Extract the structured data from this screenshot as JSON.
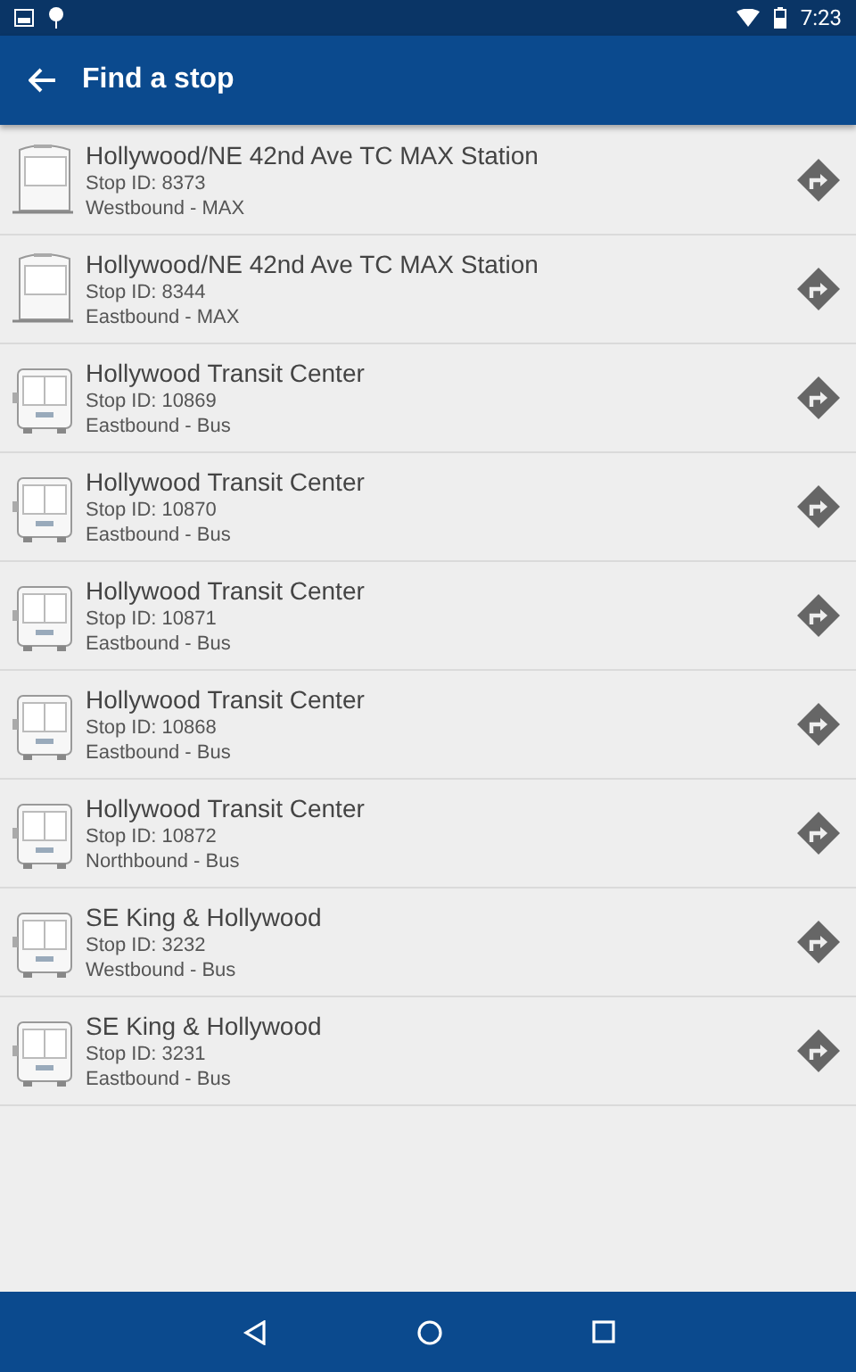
{
  "status_bar": {
    "time": "7:23"
  },
  "app_bar": {
    "title": "Find a stop"
  },
  "stops": [
    {
      "kind": "rail",
      "name": "Hollywood/NE 42nd Ave TC MAX Station",
      "stop_id": "Stop ID: 8373",
      "direction": "Westbound - MAX"
    },
    {
      "kind": "rail",
      "name": "Hollywood/NE 42nd Ave TC MAX Station",
      "stop_id": "Stop ID: 8344",
      "direction": "Eastbound - MAX"
    },
    {
      "kind": "bus",
      "name": "Hollywood Transit Center",
      "stop_id": "Stop ID: 10869",
      "direction": "Eastbound - Bus"
    },
    {
      "kind": "bus",
      "name": "Hollywood Transit Center",
      "stop_id": "Stop ID: 10870",
      "direction": "Eastbound - Bus"
    },
    {
      "kind": "bus",
      "name": "Hollywood Transit Center",
      "stop_id": "Stop ID: 10871",
      "direction": "Eastbound - Bus"
    },
    {
      "kind": "bus",
      "name": "Hollywood Transit Center",
      "stop_id": "Stop ID: 10868",
      "direction": "Eastbound - Bus"
    },
    {
      "kind": "bus",
      "name": "Hollywood Transit Center",
      "stop_id": "Stop ID: 10872",
      "direction": "Northbound - Bus"
    },
    {
      "kind": "bus",
      "name": "SE King & Hollywood",
      "stop_id": "Stop ID: 3232",
      "direction": "Westbound - Bus"
    },
    {
      "kind": "bus",
      "name": "SE King & Hollywood",
      "stop_id": "Stop ID: 3231",
      "direction": "Eastbound - Bus"
    }
  ]
}
